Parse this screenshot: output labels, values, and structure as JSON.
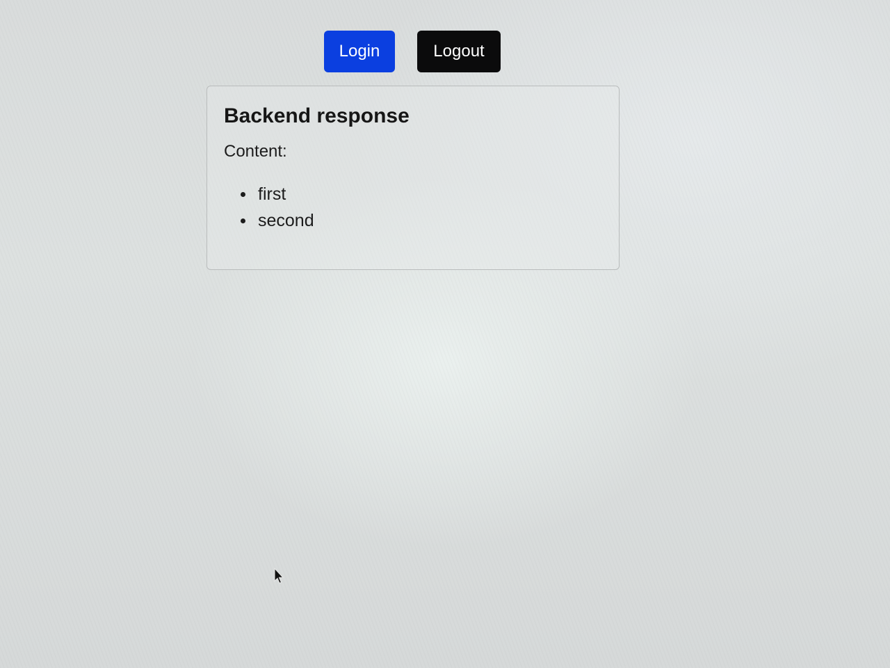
{
  "buttons": {
    "login_label": "Login",
    "logout_label": "Logout"
  },
  "card": {
    "title": "Backend response",
    "content_label": "Content:",
    "items": [
      "first",
      "second"
    ]
  },
  "colors": {
    "login_button": "#0b3fe0",
    "logout_button": "#0b0b0c",
    "button_text": "#ffffff"
  },
  "icons": {
    "pointer": "mouse-pointer-icon"
  }
}
